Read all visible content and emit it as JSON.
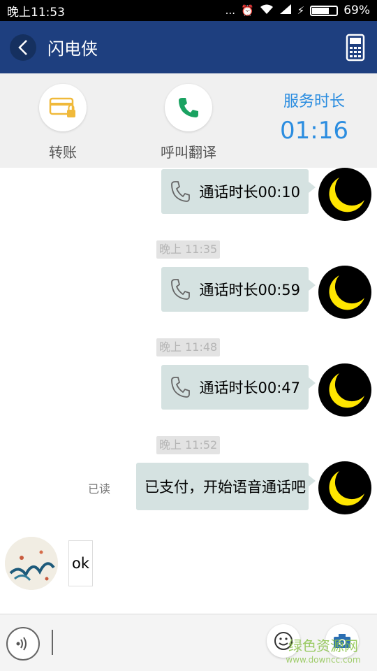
{
  "status_bar": {
    "time": "晚上11:53",
    "dots": "...",
    "battery_percent": "69%",
    "battery_level": 0.69
  },
  "nav": {
    "title": "闪电侠"
  },
  "actions": [
    {
      "label": "转账",
      "icon": "wallet-lock-icon"
    },
    {
      "label": "呼叫翻译",
      "icon": "phone-icon"
    }
  ],
  "service": {
    "label": "服务时长",
    "value": "01:16"
  },
  "messages": [
    {
      "type": "call",
      "text": "通话时长00:10"
    },
    {
      "type": "time",
      "text": "晚上 11:35"
    },
    {
      "type": "call",
      "text": "通话时长00:59"
    },
    {
      "type": "time",
      "text": "晚上 11:48"
    },
    {
      "type": "call",
      "text": "通话时长00:47"
    },
    {
      "type": "time",
      "text": "晚上 11:52"
    },
    {
      "type": "text",
      "text": "已支付，开始语音通话吧",
      "status": "已读"
    },
    {
      "type": "incoming",
      "text": "ok"
    }
  ],
  "watermark": {
    "line1": "绿色资源网",
    "line2": "www.downcc.com"
  },
  "colors": {
    "nav": "#1e3f7f",
    "accent": "#2b8de0",
    "bubble_out": "#d5e2e1",
    "moon": "#ffe600"
  }
}
